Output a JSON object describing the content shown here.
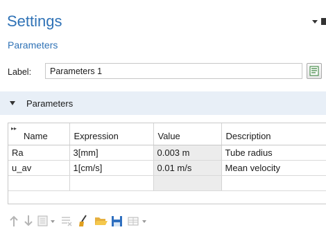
{
  "header": {
    "title": "Settings",
    "subtitle": "Parameters"
  },
  "label_row": {
    "label": "Label:",
    "value": "Parameters 1"
  },
  "section": {
    "title": "Parameters"
  },
  "table": {
    "columns": [
      "Name",
      "Expression",
      "Value",
      "Description"
    ],
    "rows": [
      [
        "Ra",
        "3[mm]",
        "0.003 m",
        "Tube radius"
      ],
      [
        "u_av",
        "1[cm/s]",
        "0.01 m/s",
        "Mean velocity"
      ],
      [
        "",
        "",
        "",
        ""
      ]
    ]
  },
  "toolbar": {
    "icons": [
      "move-up-icon",
      "move-down-icon",
      "add-icon",
      "delete-icon",
      "clear-icon",
      "load-icon",
      "save-icon",
      "table-options-icon"
    ]
  },
  "colors": {
    "accent": "#2f72b6",
    "section_bg": "#e8eff7",
    "value_cell_bg": "#ececec"
  }
}
